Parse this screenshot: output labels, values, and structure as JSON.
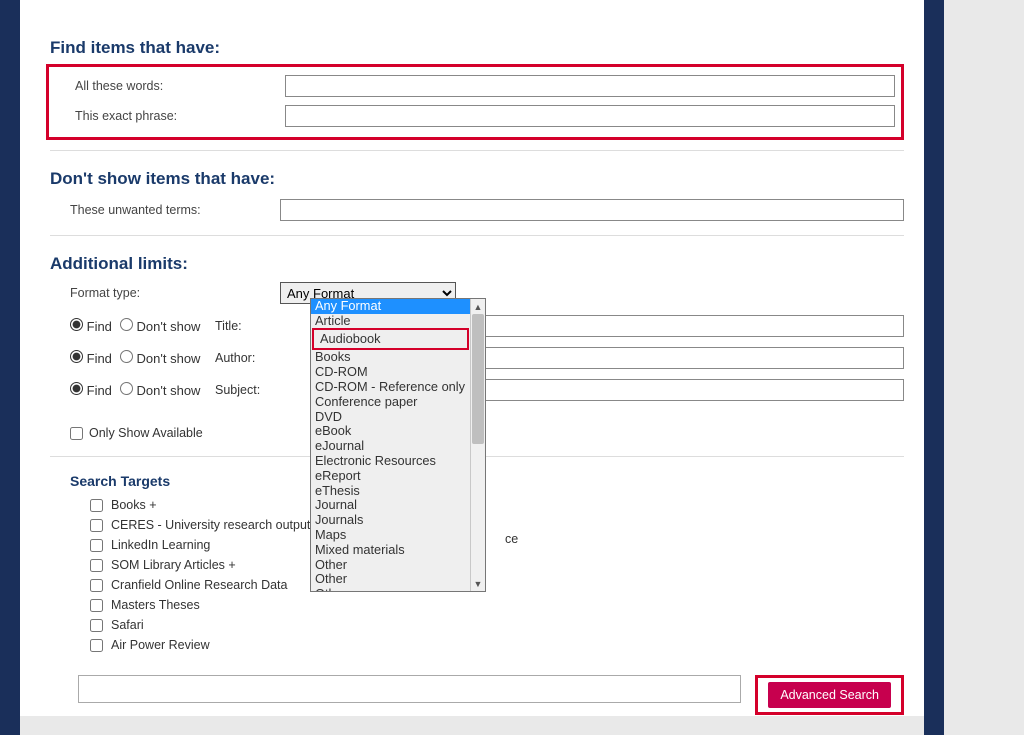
{
  "sections": {
    "find_title": "Find items that have:",
    "dont_show_title": "Don't show items that have:",
    "limits_title": "Additional limits:"
  },
  "fields": {
    "all_words_label": "All these words:",
    "exact_phrase_label": "This exact phrase:",
    "unwanted_label": "These unwanted terms:",
    "format_label": "Format type:",
    "format_selected": "Any Format",
    "title_label": "Title:",
    "author_label": "Author:",
    "subject_label": "Subject:",
    "find_radio": "Find",
    "dont_show_radio": "Don't show",
    "only_available": "Only Show Available"
  },
  "format_options": [
    "Any Format",
    "Article",
    "Audiobook",
    "Books",
    "CD-ROM",
    "CD-ROM - Reference only",
    "Conference paper",
    "DVD",
    "eBook",
    "eJournal",
    "Electronic Resources",
    "eReport",
    "eThesis",
    "Journal",
    "Journals",
    "Maps",
    "Mixed materials",
    "Other",
    "Other",
    "Other"
  ],
  "highlighted_option_index": 2,
  "targets": {
    "title": "Search Targets",
    "items": [
      "Books +",
      "CERES - University research output",
      "LinkedIn Learning",
      "SOM Library Articles +",
      "Cranfield Online Research Data",
      "Masters Theses",
      "Safari",
      "Air Power Review"
    ],
    "peek_text": "ce"
  },
  "footer": {
    "button": "Advanced Search"
  }
}
